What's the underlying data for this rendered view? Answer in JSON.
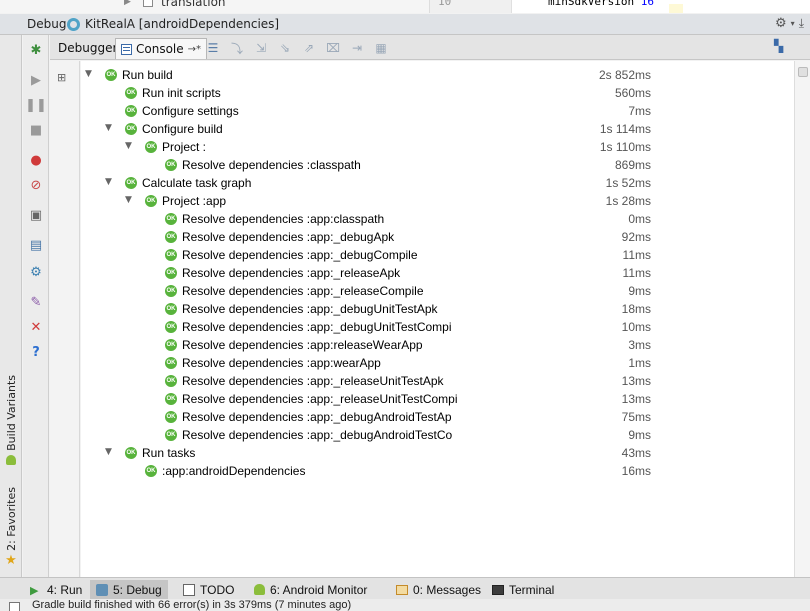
{
  "editor_remnants": {
    "tree_label": "translation",
    "line_number": "10",
    "code": "minSdkVersion",
    "code_value": "16"
  },
  "debug_window": {
    "title": "Debug",
    "run_config": "KitRealA [androidDependencies]"
  },
  "left_sidebar": {
    "build_variants": "Build Variants",
    "favorites": "2: Favorites"
  },
  "tabs": {
    "debugger": "Debugger",
    "console": "Console"
  },
  "rows": [
    {
      "label": "Run build",
      "time": "2s 852ms",
      "depth": 0,
      "expanded": true
    },
    {
      "label": "Run init scripts",
      "time": "560ms",
      "depth": 1,
      "expanded": null
    },
    {
      "label": "Configure settings",
      "time": "7ms",
      "depth": 1,
      "expanded": null
    },
    {
      "label": "Configure build",
      "time": "1s 114ms",
      "depth": 1,
      "expanded": true
    },
    {
      "label": "Project :",
      "time": "1s 110ms",
      "depth": 2,
      "expanded": true
    },
    {
      "label": "Resolve dependencies :classpath",
      "time": "869ms",
      "depth": 3,
      "expanded": null
    },
    {
      "label": "Calculate task graph",
      "time": "1s 52ms",
      "depth": 1,
      "expanded": true
    },
    {
      "label": "Project :app",
      "time": "1s 28ms",
      "depth": 2,
      "expanded": true
    },
    {
      "label": "Resolve dependencies :app:classpath",
      "time": "0ms",
      "depth": 3,
      "expanded": null
    },
    {
      "label": "Resolve dependencies :app:_debugApk",
      "time": "92ms",
      "depth": 3,
      "expanded": null
    },
    {
      "label": "Resolve dependencies :app:_debugCompile",
      "time": "11ms",
      "depth": 3,
      "expanded": null
    },
    {
      "label": "Resolve dependencies :app:_releaseApk",
      "time": "11ms",
      "depth": 3,
      "expanded": null
    },
    {
      "label": "Resolve dependencies :app:_releaseCompile",
      "time": "9ms",
      "depth": 3,
      "expanded": null
    },
    {
      "label": "Resolve dependencies :app:_debugUnitTestApk",
      "time": "18ms",
      "depth": 3,
      "expanded": null
    },
    {
      "label": "Resolve dependencies :app:_debugUnitTestCompi",
      "time": "10ms",
      "depth": 3,
      "expanded": null
    },
    {
      "label": "Resolve dependencies :app:releaseWearApp",
      "time": "3ms",
      "depth": 3,
      "expanded": null
    },
    {
      "label": "Resolve dependencies :app:wearApp",
      "time": "1ms",
      "depth": 3,
      "expanded": null
    },
    {
      "label": "Resolve dependencies :app:_releaseUnitTestApk",
      "time": "13ms",
      "depth": 3,
      "expanded": null
    },
    {
      "label": "Resolve dependencies :app:_releaseUnitTestCompi",
      "time": "13ms",
      "depth": 3,
      "expanded": null
    },
    {
      "label": "Resolve dependencies :app:_debugAndroidTestAp",
      "time": "75ms",
      "depth": 3,
      "expanded": null
    },
    {
      "label": "Resolve dependencies :app:_debugAndroidTestCo",
      "time": "9ms",
      "depth": 3,
      "expanded": null
    },
    {
      "label": "Run tasks",
      "time": "43ms",
      "depth": 1,
      "expanded": true
    },
    {
      "label": ":app:androidDependencies",
      "time": "16ms",
      "depth": 2,
      "expanded": null
    }
  ],
  "ok_badge": "OK",
  "bottom_tabs": [
    {
      "label": "4: Run",
      "icon": "run-icon",
      "active": false
    },
    {
      "label": "5: Debug",
      "icon": "debug-icon",
      "active": true
    },
    {
      "label": "TODO",
      "icon": "todo-icon",
      "active": false
    },
    {
      "label": "6: Android Monitor",
      "icon": "android-icon",
      "active": false
    },
    {
      "label": "0: Messages",
      "icon": "messages-icon",
      "active": false
    },
    {
      "label": "Terminal",
      "icon": "terminal-icon",
      "active": false
    }
  ],
  "status": {
    "text": "Gradle build finished with 66 error(s) in 3s 379ms (7 minutes ago)"
  },
  "colors": {
    "ok_green": "#58b33c",
    "console_bg": "#ffffff",
    "title_bar_bg": "#dfe2e6"
  }
}
